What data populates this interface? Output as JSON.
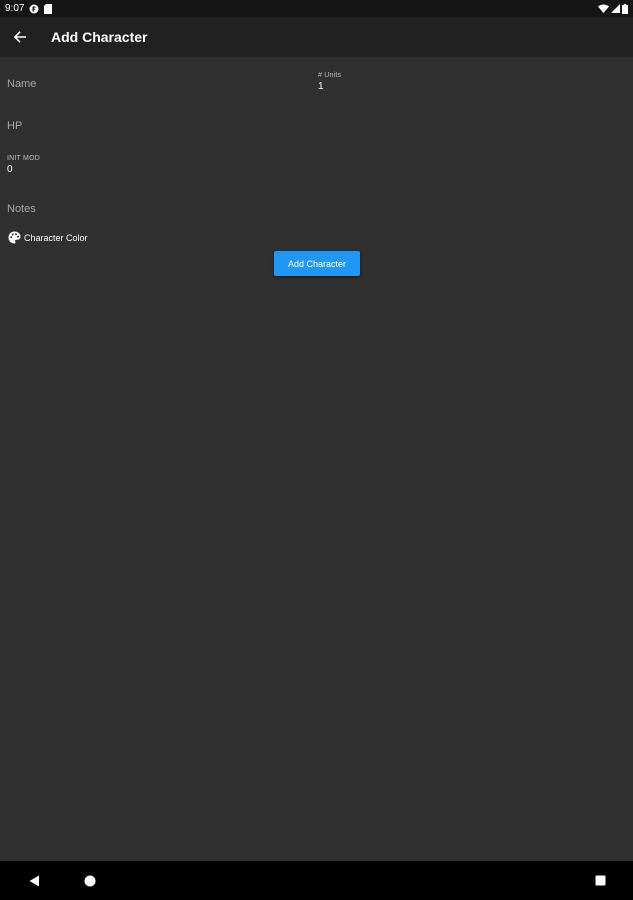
{
  "status_bar": {
    "time": "9:07",
    "icons": [
      "app-notification-icon",
      "sim-card-icon",
      "wifi-icon",
      "signal-icon",
      "battery-icon"
    ]
  },
  "app_bar": {
    "title": "Add Character",
    "back_icon": "arrow-back-icon"
  },
  "form": {
    "name": {
      "placeholder": "Name"
    },
    "units": {
      "label": "# Units",
      "value": "1"
    },
    "hp": {
      "placeholder": "HP"
    },
    "init_mod": {
      "label": "INIT MOD",
      "value": "0"
    },
    "notes": {
      "placeholder": "Notes"
    },
    "color": {
      "label": "Character Color",
      "icon": "palette-icon"
    }
  },
  "add_button": {
    "label": "Add Character",
    "color": "#2196f3"
  },
  "nav_bar": {
    "icons": [
      "back-triangle-icon",
      "home-circle-icon",
      "recents-square-icon"
    ]
  },
  "colors": {
    "background": "#303030",
    "app_bar": "#212121",
    "status_bar": "#151515",
    "nav_bar": "#000000",
    "accent": "#2196f3"
  }
}
